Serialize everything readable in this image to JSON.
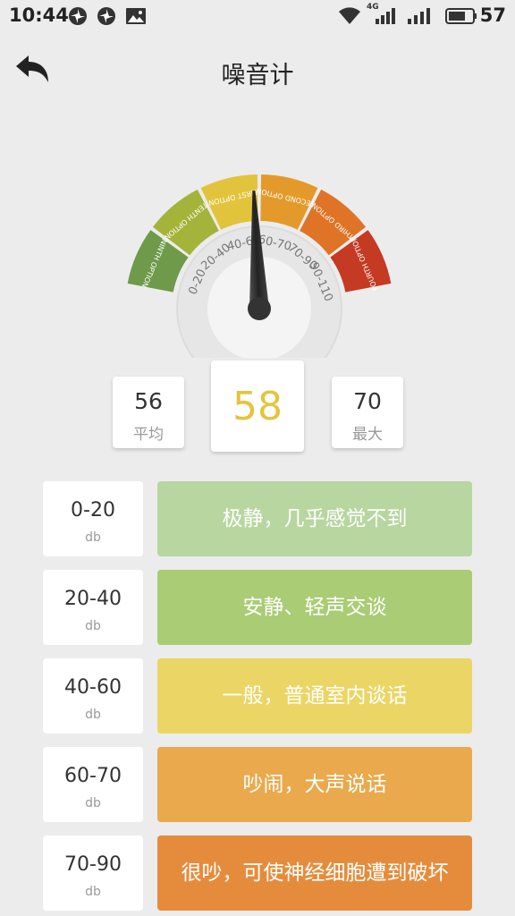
{
  "status_bar": {
    "time": "10:44",
    "network": "4G",
    "battery": "57",
    "icons": [
      "pinwheel-icon",
      "pinwheel-icon",
      "image-icon",
      "wifi-icon",
      "signal-4g-icon",
      "signal-icon",
      "battery-icon"
    ]
  },
  "header": {
    "title": "噪音计",
    "back_icon": "back-arrow-icon"
  },
  "gauge": {
    "segments": [
      {
        "label": "NINTH OPTION",
        "color": "#6e9a4a"
      },
      {
        "label": "TENTH OPTION",
        "color": "#a4b33a"
      },
      {
        "label": "FIRST OPTION",
        "color": "#e2c43c"
      },
      {
        "label": "SECOND OPTION",
        "color": "#e49a2a"
      },
      {
        "label": "THIRD OPTION",
        "color": "#df7426"
      },
      {
        "label": "FOURTH OPTION",
        "color": "#c43a23"
      }
    ],
    "ranges": [
      "0-20",
      "20-40",
      "40-60",
      "60-70",
      "70-90",
      "90-110"
    ],
    "needle_value": 58
  },
  "stats": {
    "average": {
      "value": "56",
      "label": "平均"
    },
    "current": {
      "value": "58"
    },
    "max": {
      "value": "70",
      "label": "最大"
    }
  },
  "levels": [
    {
      "range": "0-20",
      "unit": "db",
      "desc": "极静，几乎感觉不到",
      "color": "#b8d6a0"
    },
    {
      "range": "20-40",
      "unit": "db",
      "desc": "安静、轻声交谈",
      "color": "#a9cc74"
    },
    {
      "range": "40-60",
      "unit": "db",
      "desc": "一般，普通室内谈话",
      "color": "#ebd564"
    },
    {
      "range": "60-70",
      "unit": "db",
      "desc": "吵闹，大声说话",
      "color": "#e9a94c"
    },
    {
      "range": "70-90",
      "unit": "db",
      "desc": "很吵，可使神经细胞遭到破坏",
      "color": "#e58c3c"
    }
  ]
}
